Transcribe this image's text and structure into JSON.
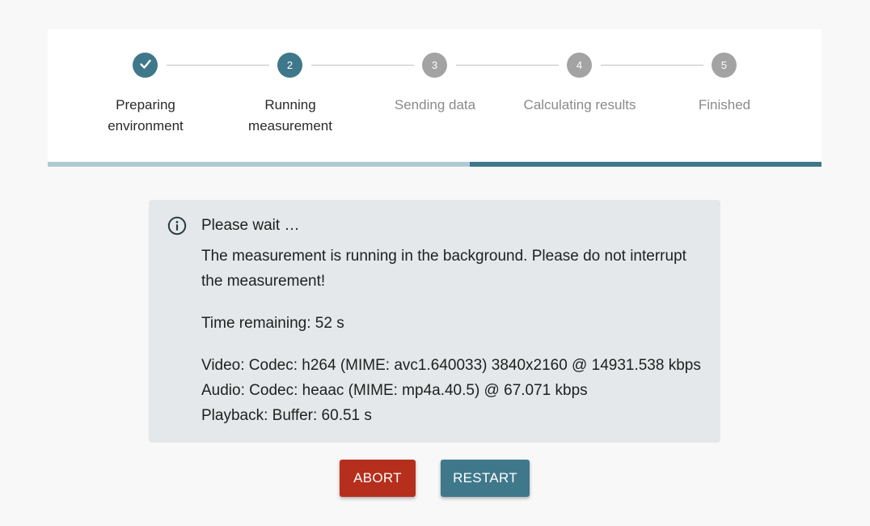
{
  "stepper": {
    "steps": [
      {
        "number": "",
        "label": "Preparing\nenvironment",
        "state": "done",
        "icon": "check-icon"
      },
      {
        "number": "2",
        "label": "Running\nmeasurement",
        "state": "active"
      },
      {
        "number": "3",
        "label": "Sending data",
        "state": "pending"
      },
      {
        "number": "4",
        "label": "Calculating results",
        "state": "pending"
      },
      {
        "number": "5",
        "label": "Finished",
        "state": "pending"
      }
    ],
    "progress_fraction": 0.545
  },
  "info": {
    "icon": "info-circle-icon",
    "title": "Please wait …",
    "message_line1": "The measurement is running in the background. Please do not interrupt",
    "message_line2": "the measurement!",
    "time_remaining": "Time remaining: 52 s",
    "video": "Video: Codec: h264 (MIME: avc1.640033) 3840x2160 @ 14931.538 kbps",
    "audio": "Audio: Codec: heaac (MIME: mp4a.40.5) @ 67.071 kbps",
    "playback": "Playback: Buffer: 60.51 s"
  },
  "actions": {
    "abort_label": "ABORT",
    "restart_label": "RESTART"
  },
  "colors": {
    "accent": "#3f788a",
    "danger": "#b62e1c",
    "pending": "#a3a3a3",
    "progress_light": "#afcad3"
  }
}
